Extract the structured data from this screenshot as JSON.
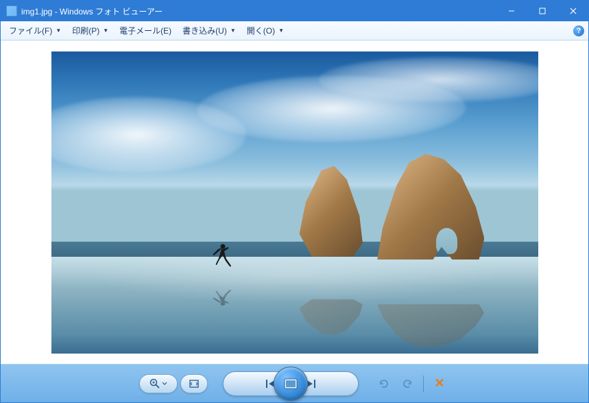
{
  "window": {
    "title": "img1.jpg - Windows フォト ビューアー"
  },
  "menu": {
    "file": "ファイル(F)",
    "print": "印刷(P)",
    "email": "電子メール(E)",
    "burn": "書き込み(U)",
    "open": "開く(O)"
  },
  "icons": {
    "help": "?",
    "zoom": "zoom-icon",
    "fit": "fit-window-icon",
    "prev": "previous-icon",
    "slideshow": "slideshow-icon",
    "next": "next-icon",
    "rotate_ccw": "rotate-ccw-icon",
    "rotate_cw": "rotate-cw-icon",
    "delete": "delete-icon",
    "minimize": "minimize-icon",
    "maximize": "maximize-icon",
    "close": "close-icon"
  },
  "image": {
    "filename": "img1.jpg"
  }
}
